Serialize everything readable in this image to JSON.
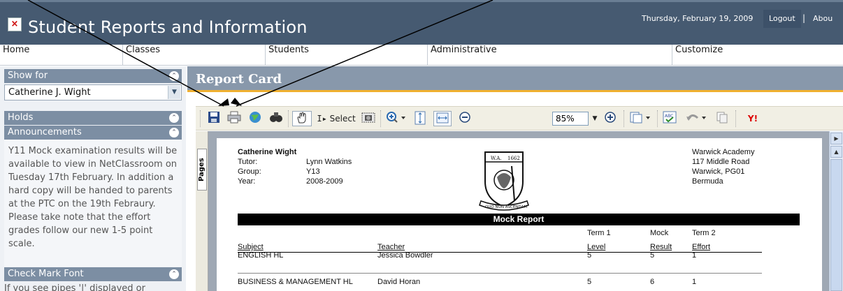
{
  "header": {
    "close_glyph": "×",
    "title": "Student Reports and Information",
    "date": "Thursday, February 19, 2009",
    "logout": "Logout",
    "separator": "|",
    "about": "Abou"
  },
  "nav": [
    "Home",
    "Classes",
    "Students",
    "Administrative",
    "Customize"
  ],
  "sidebar": {
    "show_for": "Show for",
    "student": "Catherine J. Wight",
    "holds": "Holds",
    "announcements": "Announcements",
    "announcement_text": "Y11 Mock examination results will be available to view in NetClassroom on Tuesday 17th February. In addition a hard copy will be handed to parents at the PTC on the 19th Febraury. Please take note that the effort grades follow our new 1-5 point scale.",
    "check_mark_font": "Check Mark Font",
    "check_mark_text": "If you see pipes '|' displayed or"
  },
  "main": {
    "title": "Report Card"
  },
  "toolbar": {
    "select_label": "Select",
    "zoom": "85%"
  },
  "viewer": {
    "pages_tab": "Pages"
  },
  "report": {
    "student_name": "Catherine Wight",
    "tutor_label": "Tutor:",
    "tutor": "Lynn Watkins",
    "group_label": "Group:",
    "group": "Y13",
    "year_label": "Year:",
    "year": "2008-2009",
    "school": [
      "Warwick Academy",
      "117 Middle Road",
      "Warwick, PG01",
      "Bermuda"
    ],
    "crest_motto": "QUO NON ASCENDAM",
    "crest_year": "1662",
    "banner": "Mock Report",
    "columns": {
      "subject": "Subject",
      "teacher": "Teacher",
      "term1_top": "Term 1",
      "term1_bottom": "Level",
      "mock_top": "Mock",
      "mock_bottom": "Result",
      "term2_top": "Term 2",
      "term2_bottom": "Effort"
    },
    "rows": [
      {
        "subject": "ENGLISH HL",
        "teacher": "Jessica Bowdler",
        "level": "5",
        "result": "5",
        "effort": "1"
      },
      {
        "subject": "BUSINESS & MANAGEMENT HL",
        "teacher": "David Horan",
        "level": "5",
        "result": "6",
        "effort": "1"
      }
    ]
  }
}
